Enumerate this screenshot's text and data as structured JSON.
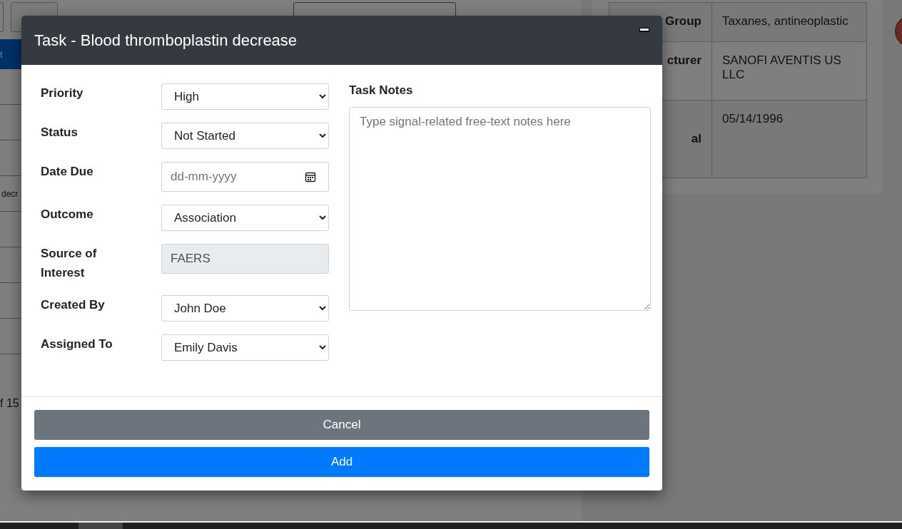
{
  "background": {
    "selected_row_text": "t",
    "table_cell": "decr",
    "pagination_text": "f 15",
    "details_table": [
      {
        "label": "Group",
        "value": "Taxanes, antineoplastic"
      },
      {
        "label": "cturer",
        "value": "SANOFI AVENTIS US LLC"
      },
      {
        "label": "al",
        "value": "05/14/1996"
      }
    ]
  },
  "dialog": {
    "title": "Task - Blood thromboplastin decrease",
    "fields": [
      {
        "label": "Priority",
        "kind": "select",
        "value": "High"
      },
      {
        "label": "Status",
        "kind": "select",
        "value": "Not Started"
      },
      {
        "label": "Date Due",
        "kind": "date",
        "placeholder": "dd-mm-yyyy"
      },
      {
        "label": "Outcome",
        "kind": "select",
        "value": "Association"
      },
      {
        "label": "Source of Interest",
        "kind": "readonly",
        "value": "FAERS"
      },
      {
        "label": "Created By",
        "kind": "select",
        "value": "John Doe"
      },
      {
        "label": "Assigned To",
        "kind": "select",
        "value": "Emily Davis"
      }
    ],
    "notes": {
      "label": "Task Notes",
      "placeholder": "Type signal-related free-text notes here"
    },
    "buttons": [
      {
        "label": "Cancel",
        "kind": "secondary"
      },
      {
        "label": "Add",
        "kind": "primary"
      }
    ]
  }
}
